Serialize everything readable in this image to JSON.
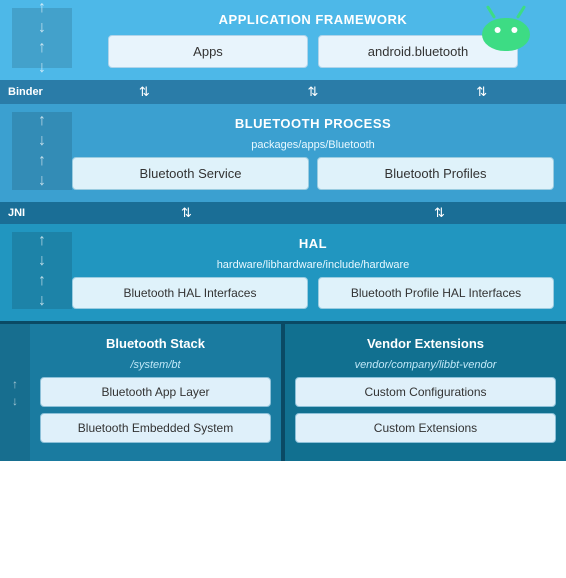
{
  "android_logo": {
    "alt": "Android Logo",
    "color": "#3ddc84"
  },
  "app_framework": {
    "title": "APPLICATION FRAMEWORK",
    "cards": [
      {
        "label": "Apps"
      },
      {
        "label": "android.bluetooth"
      }
    ],
    "binder_label": "Binder"
  },
  "bt_process": {
    "title": "BLUETOOTH PROCESS",
    "subtitle": "packages/apps/Bluetooth",
    "jni_label": "JNI",
    "cards": [
      {
        "label": "Bluetooth Service"
      },
      {
        "label": "Bluetooth Profiles"
      }
    ]
  },
  "hal": {
    "title": "HAL",
    "subtitle": "hardware/libhardware/include/hardware",
    "cards": [
      {
        "label": "Bluetooth HAL Interfaces"
      },
      {
        "label": "Bluetooth Profile HAL Interfaces"
      }
    ]
  },
  "bt_stack": {
    "title": "Bluetooth Stack",
    "subtitle": "/system/bt",
    "cards": [
      {
        "label": "Bluetooth App Layer"
      },
      {
        "label": "Bluetooth Embedded System"
      }
    ]
  },
  "vendor_ext": {
    "title": "Vendor Extensions",
    "subtitle": "vendor/company/libbt-vendor",
    "cards": [
      {
        "label": "Custom Configurations"
      },
      {
        "label": "Custom Extensions"
      }
    ]
  }
}
